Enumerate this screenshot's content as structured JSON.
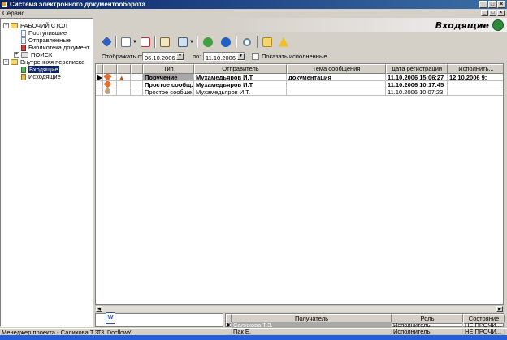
{
  "window": {
    "title": "Система электронного документооборота"
  },
  "menu": {
    "service": "Сервис"
  },
  "window_buttons": {
    "minimize": "_",
    "maximize": "□",
    "close": "×"
  },
  "tree": {
    "desktop": "РАБОЧИЙ СТОЛ",
    "incoming": "Поступившие",
    "sent": "Отправленные",
    "library": "Библиотека документ",
    "search": "ПОИСК",
    "internal": "Внутренняя переписка",
    "in": "Входящие",
    "out": "Исходящие",
    "expand_minus": "−",
    "expand_plus": "+"
  },
  "header": {
    "title": "Входящие"
  },
  "filter": {
    "from_label": "Отображать с:",
    "from_date": "06.10.2006",
    "to_label": "по:",
    "to_date": "11.10.2006",
    "show_done_label": "Показать исполненные"
  },
  "grid": {
    "columns": [
      "Тип",
      "Отправитель",
      "Тема сообщения",
      "Дата регистрации",
      "Исполнить..."
    ],
    "rows": [
      {
        "type": "Поручение",
        "sender": "Мухамедьяров И.Т.",
        "subject": "документация",
        "reg_date": "11.10.2006 15:06:27",
        "due": "12.10.2006 9:",
        "bold": true,
        "selected": true
      },
      {
        "type": "Простое сообщ...",
        "sender": "Мухамедьяров И.Т.",
        "subject": "",
        "reg_date": "11.10.2006 10:17:45",
        "due": "",
        "bold": true,
        "selected": false
      },
      {
        "type": "Простое сообще...",
        "sender": "Мухамедьяров И.Т.",
        "subject": "",
        "reg_date": "11.10.2006 10:07:23",
        "due": "",
        "bold": false,
        "selected": false
      }
    ]
  },
  "attachments": {
    "file": "Т3_DocflowУ..."
  },
  "recipients": {
    "columns": [
      "Получатель",
      "Роль",
      "Состояние"
    ],
    "rows": [
      {
        "name": "Салихова Т.З.",
        "role": "Исполнитель",
        "state": "НЕ ПРОЧИ..."
      },
      {
        "name": "Пак Е.",
        "role": "Исполнитель",
        "state": "НЕ ПРОЧИ..."
      }
    ]
  },
  "status": {
    "text": "Менеджер проекта - Салихова Т.З."
  },
  "colors": {
    "titlebar": "#0a246a",
    "selection": "#0a246a",
    "row_selected": "#a8a8a8",
    "window_bg": "#d4d0c8"
  }
}
